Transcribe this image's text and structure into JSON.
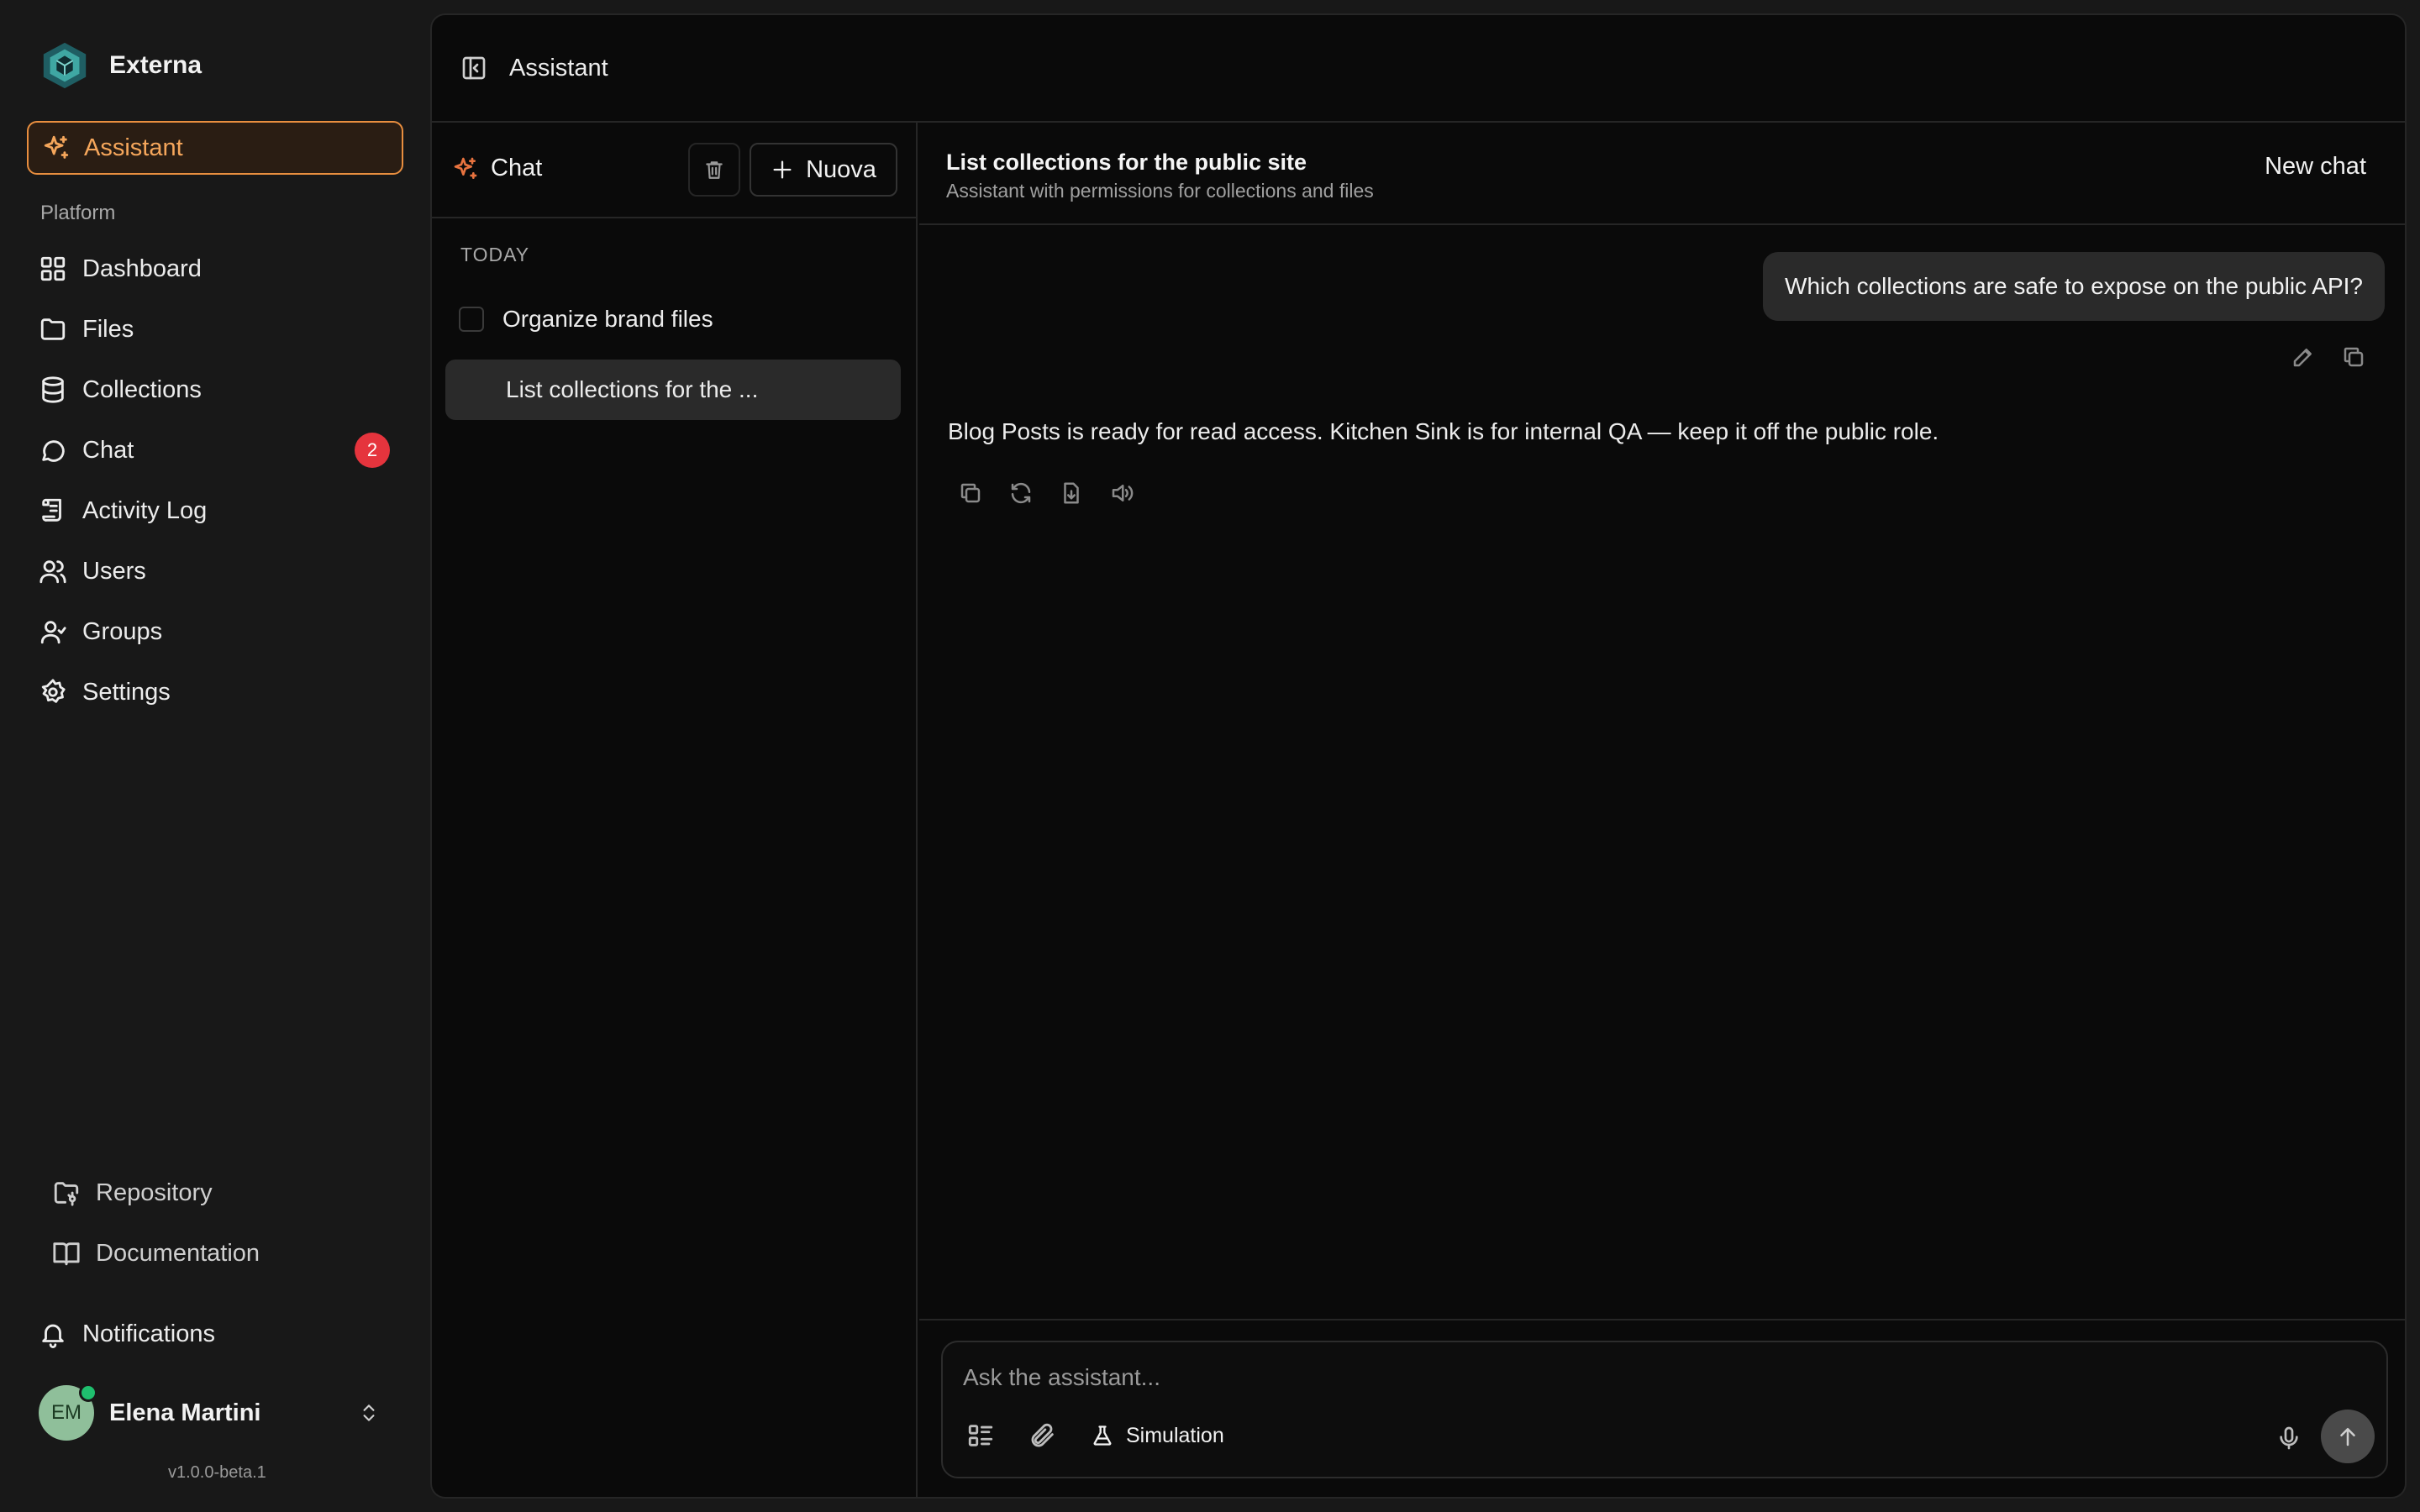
{
  "sidebar": {
    "brand": "Externa",
    "assistant_label": "Assistant",
    "section_label": "Platform",
    "nav": [
      {
        "label": "Dashboard",
        "icon": "dashboard-icon"
      },
      {
        "label": "Files",
        "icon": "folder-icon"
      },
      {
        "label": "Collections",
        "icon": "database-icon"
      },
      {
        "label": "Chat",
        "icon": "chat-icon",
        "badge": "2"
      },
      {
        "label": "Activity Log",
        "icon": "scroll-icon"
      },
      {
        "label": "Users",
        "icon": "users-icon"
      },
      {
        "label": "Groups",
        "icon": "groups-icon"
      },
      {
        "label": "Settings",
        "icon": "gear-icon"
      }
    ],
    "bottom_links": [
      {
        "label": "Repository",
        "icon": "repository-icon"
      },
      {
        "label": "Documentation",
        "icon": "book-icon"
      }
    ],
    "notifications_label": "Notifications",
    "user": {
      "initials": "EM",
      "name": "Elena Martini"
    },
    "version": "v1.0.0-beta.1"
  },
  "topbar": {
    "title": "Assistant"
  },
  "chat_list": {
    "title": "Chat",
    "new_label": "Nuova",
    "group_label": "TODAY",
    "items": [
      {
        "label": "Organize brand files"
      },
      {
        "label": "List collections for the ..."
      }
    ]
  },
  "conversation": {
    "title": "List collections for the public site",
    "subtitle": "Assistant with permissions for collections and files",
    "new_chat_label": "New chat",
    "user_message": "Which collections are safe to expose on the public API?",
    "assistant_message": "Blog Posts is ready for read access. Kitchen Sink is for internal QA — keep it off the public role."
  },
  "composer": {
    "placeholder": "Ask the assistant...",
    "simulation_label": "Simulation"
  },
  "colors": {
    "accent": "#e88e3f",
    "badge": "#e5343d",
    "online": "#1fbf6e",
    "brand_logo": "#3fa7a3"
  }
}
